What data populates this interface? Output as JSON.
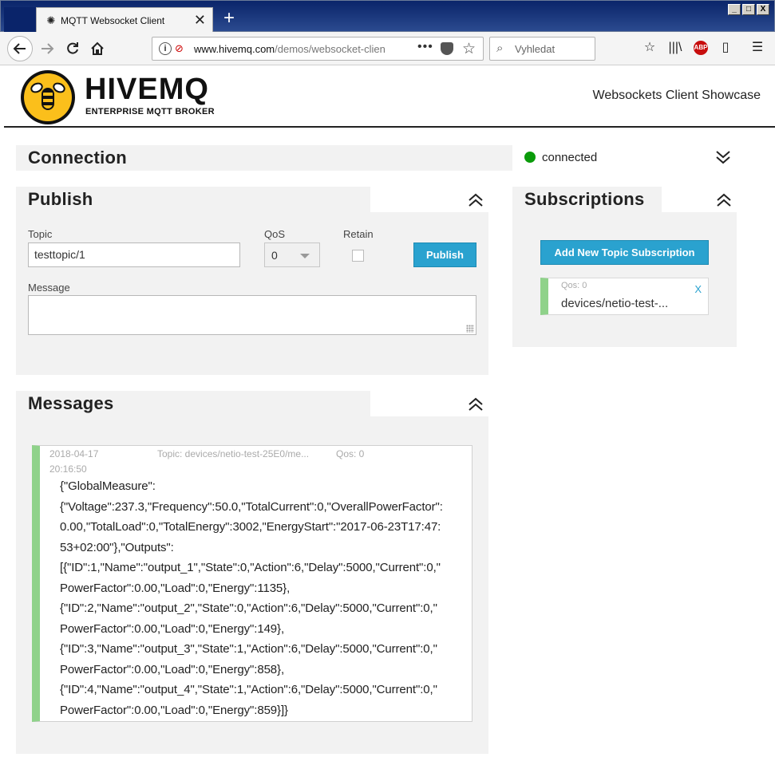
{
  "browser": {
    "tab_title": "MQTT Websocket Client",
    "tab_close": "✕",
    "new_tab": "+",
    "url_host": "www.hivemq.com",
    "url_path": "/demos/websocket-clien",
    "url_prefix": "www.",
    "search_placeholder": "Vyhledat",
    "url_more": "•••",
    "window_controls": [
      "_",
      "□",
      "X"
    ]
  },
  "header": {
    "logo_text": "HIVEMQ",
    "logo_sub": "ENTERPRISE MQTT BROKER",
    "right_title": "Websockets Client Showcase"
  },
  "connection": {
    "title": "Connection",
    "status": "connected",
    "status_color": "#0a9b0a"
  },
  "publish": {
    "title": "Publish",
    "topic_label": "Topic",
    "topic_value": "testtopic/1",
    "qos_label": "QoS",
    "qos_value": "0",
    "retain_label": "Retain",
    "button_label": "Publish",
    "message_label": "Message",
    "message_value": ""
  },
  "subscriptions": {
    "title": "Subscriptions",
    "add_button": "Add New Topic Subscription",
    "items": [
      {
        "qos": "Qos: 0",
        "topic": "devices/netio-test-...",
        "close": "X",
        "color": "#8fd28a"
      }
    ]
  },
  "messages": {
    "title": "Messages",
    "items": [
      {
        "date": "2018-04-17",
        "time": "20:16:50",
        "topic": "Topic: devices/netio-test-25E0/me...",
        "qos": "Qos: 0",
        "lines": [
          "{\"GlobalMeasure\":",
          "{\"Voltage\":237.3,\"Frequency\":50.0,\"TotalCurrent\":0,\"OverallPowerFactor\":",
          "0.00,\"TotalLoad\":0,\"TotalEnergy\":3002,\"EnergyStart\":\"2017-06-23T17:47:",
          "53+02:00\"},\"Outputs\":",
          "[{\"ID\":1,\"Name\":\"output_1\",\"State\":0,\"Action\":6,\"Delay\":5000,\"Current\":0,\"",
          "PowerFactor\":0.00,\"Load\":0,\"Energy\":1135},",
          "{\"ID\":2,\"Name\":\"output_2\",\"State\":0,\"Action\":6,\"Delay\":5000,\"Current\":0,\"",
          "PowerFactor\":0.00,\"Load\":0,\"Energy\":149},",
          "{\"ID\":3,\"Name\":\"output_3\",\"State\":1,\"Action\":6,\"Delay\":5000,\"Current\":0,\"",
          "PowerFactor\":0.00,\"Load\":0,\"Energy\":858},",
          "{\"ID\":4,\"Name\":\"output_4\",\"State\":1,\"Action\":6,\"Delay\":5000,\"Current\":0,\"",
          "PowerFactor\":0.00,\"Load\":0,\"Energy\":859}]}"
        ]
      }
    ]
  }
}
